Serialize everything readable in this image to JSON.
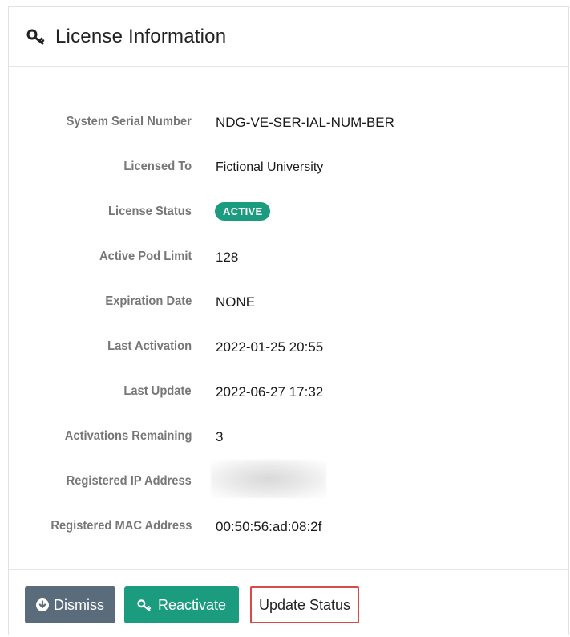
{
  "panel": {
    "title": "License Information",
    "title_icon": "key-icon"
  },
  "fields": [
    {
      "label": "System Serial Number",
      "value": "NDG-VE-SER-IAL-NUM-BER"
    },
    {
      "label": "Licensed To",
      "value": "Fictional University"
    },
    {
      "label": "License Status",
      "value": "ACTIVE"
    },
    {
      "label": "Active Pod Limit",
      "value": "128"
    },
    {
      "label": "Expiration Date",
      "value": "NONE"
    },
    {
      "label": "Last Activation",
      "value": "2022-01-25 20:55"
    },
    {
      "label": "Last Update",
      "value": "2022-06-27 17:32"
    },
    {
      "label": "Activations Remaining",
      "value": "3"
    },
    {
      "label": "Registered IP Address",
      "value": ""
    },
    {
      "label": "Registered MAC Address",
      "value": "00:50:56:ad:08:2f"
    }
  ],
  "buttons": {
    "dismiss": {
      "label": "Dismiss",
      "icon": "download-circle-icon"
    },
    "reactivate": {
      "label": "Reactivate",
      "icon": "key-icon"
    },
    "update_status": {
      "label": "Update Status"
    }
  },
  "colors": {
    "accent": "#1c9c7f",
    "dismiss": "#5a6b7b",
    "highlight_border": "#d84a4a"
  }
}
